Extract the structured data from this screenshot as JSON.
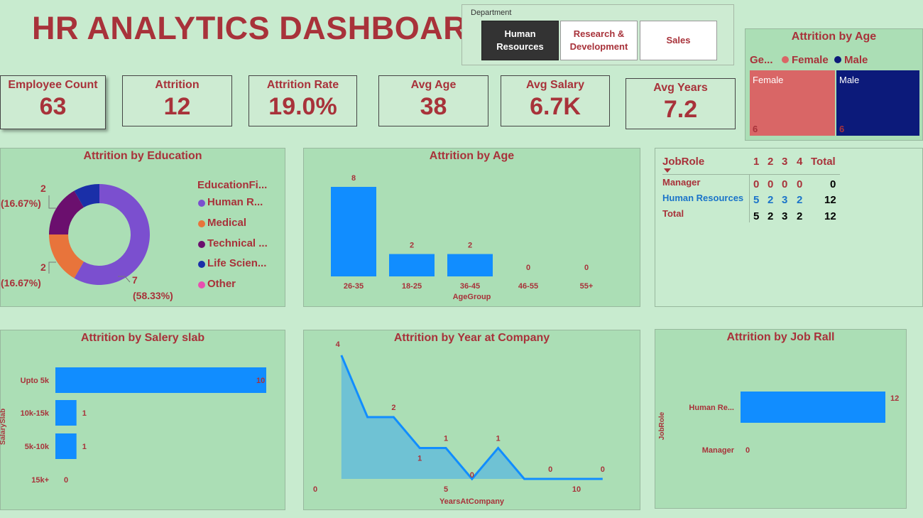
{
  "title": "HR ANALYTICS DASHBOARD",
  "slicer": {
    "label": "Department",
    "options": [
      "Human Resources",
      "Research & Development",
      "Sales"
    ],
    "option_lines": [
      [
        "Human",
        "Resources"
      ],
      [
        "Research &",
        "Development"
      ],
      [
        "Sales"
      ]
    ],
    "selected": "Human Resources"
  },
  "kpis": [
    {
      "label": "Employee Count",
      "value": "63"
    },
    {
      "label": "Attrition",
      "value": "12"
    },
    {
      "label": "Attrition Rate",
      "value": "19.0%"
    },
    {
      "label": "Avg Age",
      "value": "38"
    },
    {
      "label": "Avg Salary",
      "value": "6.7K"
    },
    {
      "label": "Avg Years",
      "value": "7.2"
    }
  ],
  "gender_panel": {
    "title": "Attrition by Age",
    "legend_title": "Ge...",
    "legend": [
      {
        "name": "Female",
        "color": "#d96666"
      },
      {
        "name": "Male",
        "color": "#0c1a7a"
      }
    ],
    "tiles": [
      {
        "name": "Female",
        "value": "6"
      },
      {
        "name": "Male",
        "value": "6"
      }
    ]
  },
  "education_panel": {
    "title": "Attrition by Education",
    "legend_title": "EducationFi...",
    "legend": [
      {
        "name": "Human R...",
        "color": "#7b4fcf"
      },
      {
        "name": "Medical",
        "color": "#e8743b"
      },
      {
        "name": "Technical ...",
        "color": "#6b0f6e"
      },
      {
        "name": "Life Scien...",
        "color": "#1a2fa8"
      },
      {
        "name": "Other",
        "color": "#e84fb0"
      }
    ],
    "labels": [
      {
        "count": "2",
        "pct": "(16.67%)"
      },
      {
        "count": "2",
        "pct": "(16.67%)"
      },
      {
        "count": "7",
        "pct": "(58.33%)"
      }
    ]
  },
  "matrix": {
    "headers": [
      "JobRole",
      "1",
      "2",
      "3",
      "4",
      "Total"
    ],
    "rows": [
      {
        "label": "Manager",
        "cells": [
          "0",
          "0",
          "0",
          "0",
          "0"
        ]
      },
      {
        "label": "Human Resources",
        "cells": [
          "5",
          "2",
          "3",
          "2",
          "12"
        ]
      },
      {
        "label": "Total",
        "cells": [
          "5",
          "2",
          "3",
          "2",
          "12"
        ]
      }
    ]
  },
  "chart_data": [
    {
      "type": "pie",
      "title": "Attrition by Education",
      "categories": [
        "Human R...",
        "Medical",
        "Technical ...",
        "Life Scien...",
        "Other"
      ],
      "values": [
        7,
        2,
        2,
        1,
        0
      ],
      "legend_position": "right"
    },
    {
      "type": "bar",
      "title": "Attrition by Age",
      "categories": [
        "26-35",
        "18-25",
        "36-45",
        "46-55",
        "55+"
      ],
      "values": [
        8,
        2,
        2,
        0,
        0
      ],
      "xlabel": "AgeGroup",
      "ylabel": "",
      "color": "#118dff"
    },
    {
      "type": "bar",
      "orientation": "horizontal",
      "title": "Attrition by Salery slab",
      "categories": [
        "Upto 5k",
        "10k-15k",
        "5k-10k",
        "15k+"
      ],
      "values": [
        10,
        1,
        1,
        0
      ],
      "xlabel": "",
      "ylabel": "SalarySlab",
      "color": "#118dff"
    },
    {
      "type": "area",
      "title": "Attrition by Year at Company",
      "x": [
        1,
        2,
        3,
        4,
        5,
        6,
        7,
        8,
        9,
        10,
        11
      ],
      "values": [
        4,
        2,
        2,
        1,
        1,
        0,
        1,
        0,
        0,
        0,
        0
      ],
      "x_ticks": [
        0,
        5,
        10
      ],
      "xlim": [
        0,
        11
      ],
      "ylim": [
        0,
        4
      ],
      "xlabel": "YearsAtCompany",
      "ylabel": "",
      "color": "#118dff",
      "fill": "#6fc2d4"
    },
    {
      "type": "bar",
      "orientation": "horizontal",
      "title": "Attrition by Job Rall",
      "categories": [
        "Human Re...",
        "Manager"
      ],
      "values": [
        12,
        0
      ],
      "xlabel": "",
      "ylabel": "JobRole",
      "color": "#118dff"
    }
  ]
}
